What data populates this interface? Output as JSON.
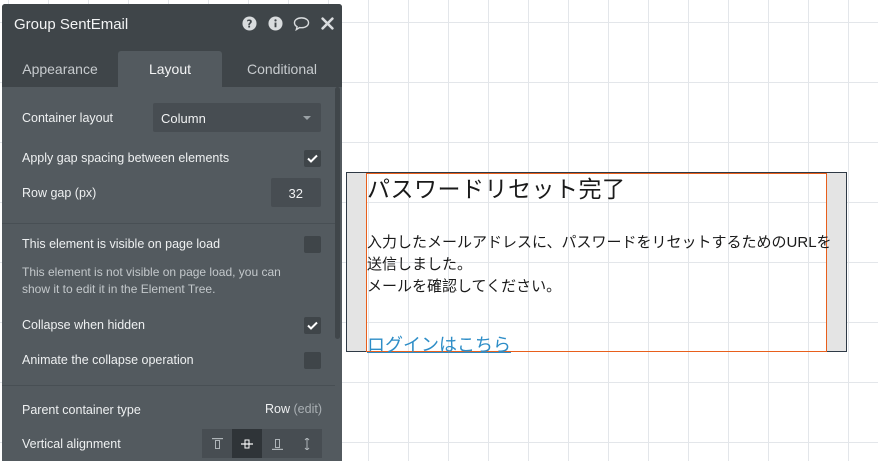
{
  "panel": {
    "title": "Group SentEmail",
    "icons": [
      "help-icon",
      "info-icon",
      "comment-icon",
      "close-icon"
    ],
    "tabs": [
      {
        "label": "Appearance",
        "active": false
      },
      {
        "label": "Layout",
        "active": true
      },
      {
        "label": "Conditional",
        "active": false
      }
    ],
    "container_layout": {
      "label": "Container layout",
      "value": "Column"
    },
    "gap_spacing": {
      "label": "Apply gap spacing between elements",
      "checked": true
    },
    "row_gap": {
      "label": "Row gap (px)",
      "value": "32"
    },
    "visible_on_load": {
      "label": "This element is visible on page load",
      "checked": false,
      "hint": "This element is not visible on page load, you can show it to edit it in the Element Tree."
    },
    "collapse_hidden": {
      "label": "Collapse when hidden",
      "checked": true
    },
    "animate_collapse": {
      "label": "Animate the collapse operation",
      "checked": false
    },
    "parent_container": {
      "label": "Parent container type",
      "value": "Row",
      "edit": "(edit)"
    },
    "vertical_alignment": {
      "label": "Vertical alignment",
      "options": [
        "top",
        "center",
        "bottom",
        "stretch"
      ],
      "selected": "center"
    }
  },
  "canvas": {
    "heading": "パスワードリセット完了",
    "body_lines": [
      "入力したメールアドレスに、パスワードをリセットするためのURLを",
      "送信しました。",
      "メールを確認してください。"
    ],
    "link": "ログインはこちら"
  },
  "colors": {
    "panel_bg": "#535a5f",
    "panel_header": "#3f4549",
    "selection_border": "#e85f1c",
    "link": "#2d8dc7"
  }
}
